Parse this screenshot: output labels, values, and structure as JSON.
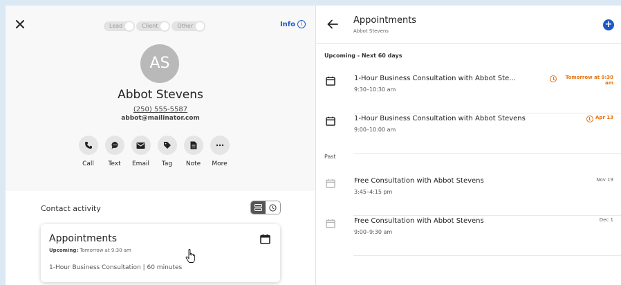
{
  "contact": {
    "stages": [
      "Lead",
      "Client",
      "Other"
    ],
    "info_label": "Info",
    "initials": "AS",
    "name": "Abbot Stevens",
    "phone": "(250) 555-5587",
    "email": "abbot@mailinator.com",
    "actions": [
      {
        "label": "Call",
        "icon": "phone-icon"
      },
      {
        "label": "Text",
        "icon": "chat-icon"
      },
      {
        "label": "Email",
        "icon": "mail-icon"
      },
      {
        "label": "Tag",
        "icon": "tag-icon"
      },
      {
        "label": "Note",
        "icon": "note-icon"
      },
      {
        "label": "More",
        "icon": "more-icon"
      }
    ]
  },
  "activity": {
    "label": "Contact activity",
    "card": {
      "title": "Appointments",
      "upcoming_label": "Upcoming:",
      "upcoming_value": "Tomorrow at 9:30 am",
      "detail": "1-Hour Business Consultation | 60 minutes"
    }
  },
  "appointments": {
    "title": "Appointments",
    "subtitle": "Abbot Stevens",
    "upcoming_label": "Upcoming - Next 60 days",
    "past_label": "Past",
    "upcoming": [
      {
        "title": "1-Hour Business Consultation with Abbot Ste...",
        "time": "9:30–10:30 am",
        "date": "Tomorrow at 9:30 am"
      },
      {
        "title": "1-Hour Business Consultation with Abbot Stevens",
        "time": "9:00–10:00 am",
        "date": "Apr 13"
      }
    ],
    "past": [
      {
        "title": "Free Consultation with Abbot Stevens",
        "time": "3:45–4:15 pm",
        "date": "Nov 19"
      },
      {
        "title": "Free Consultation with Abbot Stevens",
        "time": "9:00–9:30 am",
        "date": "Dec 1"
      }
    ]
  },
  "colors": {
    "accent": "#1d59c6",
    "warning": "#e8710a",
    "background": "#dbe9f4"
  }
}
